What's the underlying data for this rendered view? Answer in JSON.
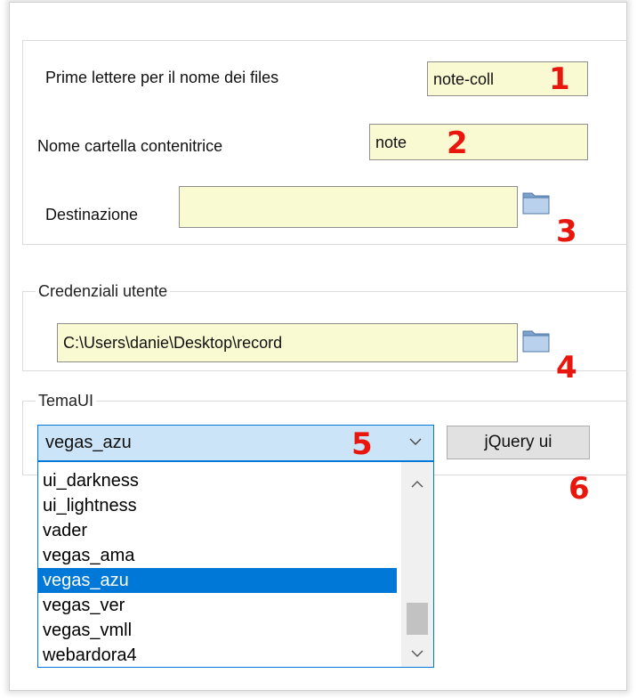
{
  "fields": {
    "prefix": {
      "label": "Prime lettere per il nome dei files",
      "value": "note-coll",
      "badge": "1"
    },
    "folder": {
      "label": "Nome cartella contenitrice",
      "value": "note",
      "badge": "2"
    },
    "destination": {
      "label": "Destinazione",
      "value": "",
      "badge": "3"
    }
  },
  "credentials": {
    "legend": "Credenziali utente",
    "path": "C:\\Users\\danie\\Desktop\\record",
    "badge": "4"
  },
  "theme": {
    "legend": "TemaUI",
    "selected": "vegas_azu",
    "badge": "5",
    "button_label": "jQuery ui",
    "button_badge": "6",
    "options": [
      "ui_darkness",
      "ui_lightness",
      "vader",
      "vegas_ama",
      "vegas_azu",
      "vegas_ver",
      "vegas_vmll",
      "webardora4"
    ],
    "highlighted_index": 4
  },
  "colors": {
    "field_bg": "#fafad2",
    "accent": "#0078d7",
    "badge": "#e8160c"
  },
  "icons": [
    "folder-browse-icon",
    "chevron-down-icon",
    "scroll-up-icon",
    "scroll-down-icon"
  ]
}
